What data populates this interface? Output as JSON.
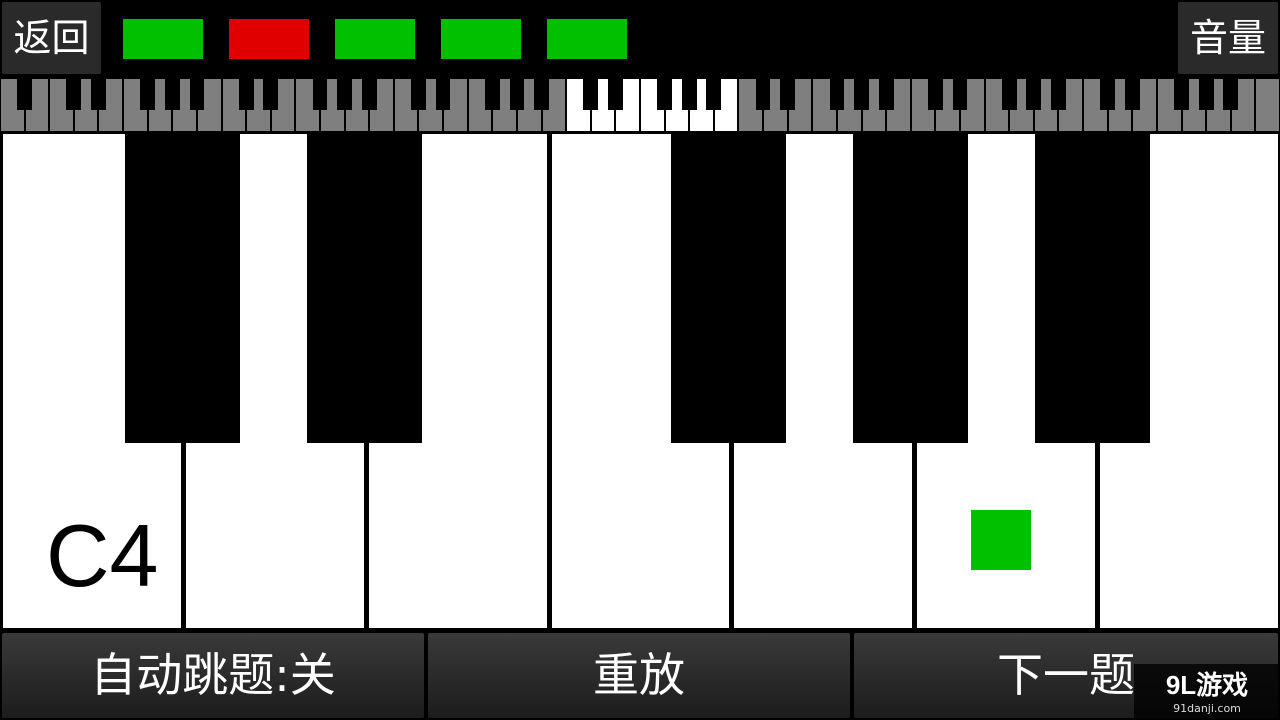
{
  "top_bar": {
    "back_label": "返回",
    "volume_label": "音量"
  },
  "score_boxes": [
    {
      "status": "correct",
      "color": "#00c000"
    },
    {
      "status": "wrong",
      "color": "#e00000"
    },
    {
      "status": "correct",
      "color": "#00c000"
    },
    {
      "status": "correct",
      "color": "#00c000"
    },
    {
      "status": "correct",
      "color": "#00c000"
    }
  ],
  "mini_keyboard": {
    "visible_range_highlighted": "C4-B4"
  },
  "keyboard": {
    "note_label": "C4",
    "white_keys": [
      "C",
      "D",
      "E",
      "F",
      "G",
      "A",
      "B"
    ],
    "marker_key": "A",
    "marker_color": "#00c000"
  },
  "bottom_bar": {
    "auto_label": "自动跳题:关",
    "replay_label": "重放",
    "next_label": "下一题"
  },
  "watermark": {
    "logo": "9L游戏",
    "url": "91danji.com"
  }
}
